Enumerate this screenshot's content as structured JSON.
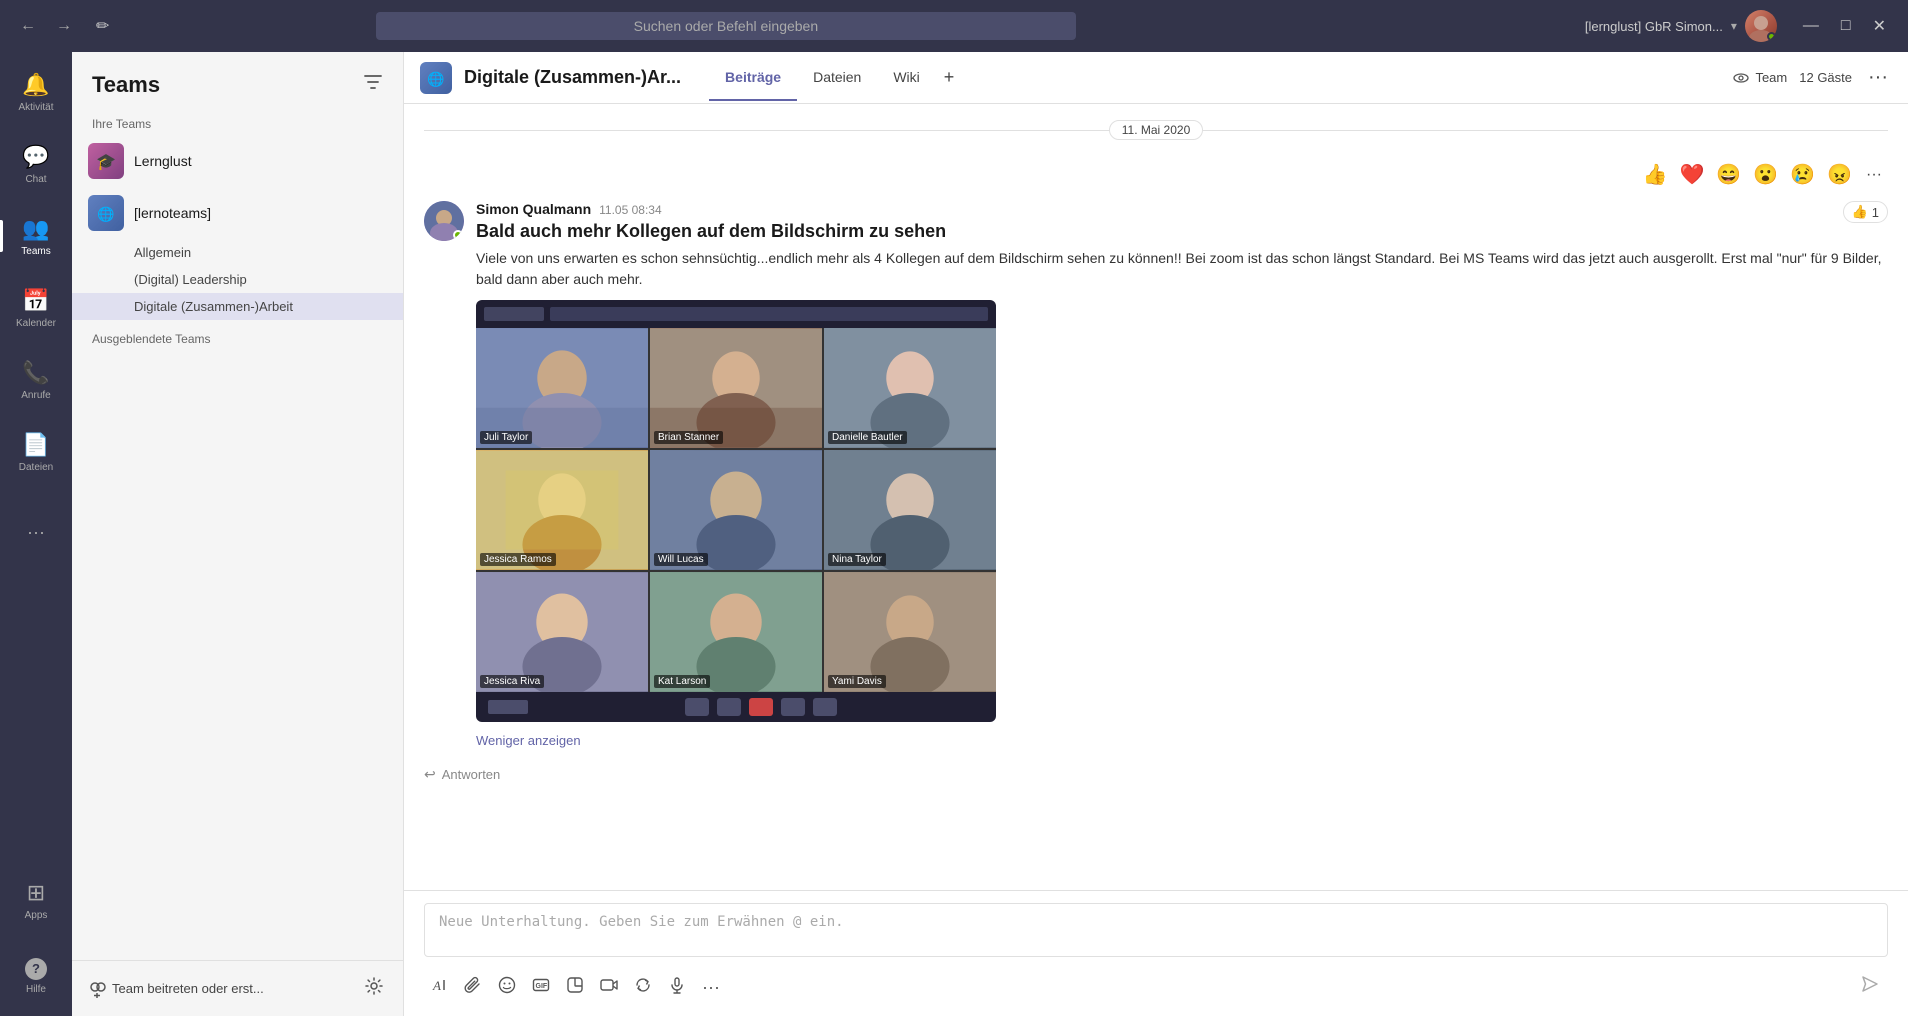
{
  "topbar": {
    "nav_back": "←",
    "nav_forward": "→",
    "search_placeholder": "Suchen oder Befehl eingeben",
    "user_name": "[lernglust] GbR Simon...",
    "compose_icon": "✏",
    "minimize": "—",
    "maximize": "□",
    "close": "✕"
  },
  "sidebar": {
    "items": [
      {
        "id": "aktivitat",
        "label": "Aktivität",
        "icon": "🔔"
      },
      {
        "id": "chat",
        "label": "Chat",
        "icon": "💬"
      },
      {
        "id": "teams",
        "label": "Teams",
        "icon": "👥",
        "active": true
      },
      {
        "id": "kalender",
        "label": "Kalender",
        "icon": "📅"
      },
      {
        "id": "anrufe",
        "label": "Anrufe",
        "icon": "📞"
      },
      {
        "id": "dateien",
        "label": "Dateien",
        "icon": "📄"
      }
    ],
    "more": {
      "label": "···"
    },
    "apps": {
      "label": "Apps",
      "icon": "⊞"
    },
    "hilfe": {
      "label": "Hilfe",
      "icon": "?"
    }
  },
  "teams_panel": {
    "title": "Teams",
    "filter_icon": "⚡",
    "section_label": "Ihre Teams",
    "teams": [
      {
        "id": "lernglust",
        "name": "Lernglust",
        "logo_class": "logo-lernglust"
      },
      {
        "id": "lernoteams",
        "name": "[lernoteams]",
        "logo_class": "logo-lernoteams",
        "channels": [
          {
            "id": "allgemein",
            "name": "Allgemein"
          },
          {
            "id": "digital-leadership",
            "name": "(Digital) Leadership"
          },
          {
            "id": "digitale-zusammenarbeit",
            "name": "Digitale (Zusammen-)Arbeit",
            "active": true
          }
        ]
      }
    ],
    "hidden_teams_label": "Ausgeblendete Teams",
    "footer": {
      "join_icon": "➕👥",
      "join_label": "Team beitreten oder erst...",
      "settings_icon": "⚙"
    }
  },
  "channel_header": {
    "title": "Digitale (Zusammen-)Ar...",
    "tabs": [
      {
        "id": "beitraege",
        "label": "Beiträge",
        "active": true
      },
      {
        "id": "dateien",
        "label": "Dateien"
      },
      {
        "id": "wiki",
        "label": "Wiki"
      }
    ],
    "add_tab": "+",
    "team_view_icon": "👁",
    "team_view_label": "Team",
    "guests_count": "12 Gäste",
    "more_options": "···"
  },
  "message": {
    "date": "11. Mai 2020",
    "author": "Simon Qualmann",
    "timestamp": "11.05 08:34",
    "title": "Bald auch mehr Kollegen auf dem Bildschirm zu sehen",
    "body": "Viele von uns erwarten es schon sehnsüchtig...endlich mehr als 4 Kollegen auf dem Bildschirm sehen zu können!! Bei zoom ist das schon längst Standard. Bei MS Teams wird das jetzt auch ausgerollt. Erst mal \"nur\" für 9 Bilder, bald dann aber auch mehr.",
    "show_less": "Weniger anzeigen",
    "reply": "Antworten",
    "like_count": "1",
    "reactions": [
      "👍",
      "❤️",
      "😄",
      "😮",
      "😢",
      "😠"
    ],
    "video_cells": [
      {
        "id": 1,
        "name": "Juli Taylor",
        "class": "person-1"
      },
      {
        "id": 2,
        "name": "Brian Stanner",
        "class": "person-2"
      },
      {
        "id": 3,
        "name": "Danielle Bautler",
        "class": "person-3"
      },
      {
        "id": 4,
        "name": "Jessica Ramos",
        "class": "person-4"
      },
      {
        "id": 5,
        "name": "Will Lucas",
        "class": "person-5"
      },
      {
        "id": 6,
        "name": "Nina Taylor",
        "class": "person-6"
      },
      {
        "id": 7,
        "name": "Jessica Riva",
        "class": "person-7"
      },
      {
        "id": 8,
        "name": "Kat Larson",
        "class": "person-8"
      },
      {
        "id": 9,
        "name": "Yami Davis",
        "class": "person-9"
      }
    ]
  },
  "compose": {
    "placeholder": "Neue Unterhaltung. Geben Sie zum Erwähnen @ ein.",
    "tools": [
      {
        "id": "format",
        "icon": "A",
        "label": "Formatierung"
      },
      {
        "id": "attach",
        "icon": "📎",
        "label": "Anhang"
      },
      {
        "id": "emoji",
        "icon": "😊",
        "label": "Emoji"
      },
      {
        "id": "gif",
        "icon": "GIF",
        "label": "GIF"
      },
      {
        "id": "sticker",
        "icon": "🏷",
        "label": "Sticker"
      },
      {
        "id": "meet",
        "icon": "📹",
        "label": "Meeting"
      },
      {
        "id": "loop",
        "icon": "↩",
        "label": "Loop"
      },
      {
        "id": "audio",
        "icon": "🎤",
        "label": "Audio"
      },
      {
        "id": "more",
        "icon": "···",
        "label": "Mehr"
      }
    ],
    "send_icon": "➤"
  }
}
